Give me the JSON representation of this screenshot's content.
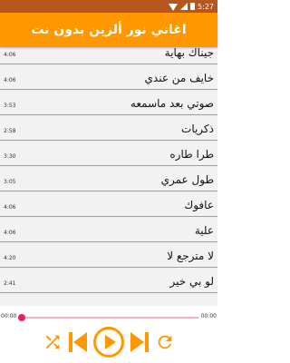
{
  "status_bar": {
    "time": "5:27"
  },
  "app_bar": {
    "title": "اغاني نور ألزين بدون نت"
  },
  "tracks": [
    {
      "title": "جيناك بهاية",
      "duration": "4:06"
    },
    {
      "title": "خايف من عندي",
      "duration": "4:06"
    },
    {
      "title": "صوتي بعد ماسمعه",
      "duration": "3:53"
    },
    {
      "title": "ذكريات",
      "duration": "2:58"
    },
    {
      "title": "طرا طاره",
      "duration": "3:30"
    },
    {
      "title": "طول عمري",
      "duration": "3:05"
    },
    {
      "title": "عافوك",
      "duration": "4:06"
    },
    {
      "title": "علية",
      "duration": "4:06"
    },
    {
      "title": "لا مترجع لا",
      "duration": "4:20"
    },
    {
      "title": "لو بي خير",
      "duration": "2:41"
    }
  ],
  "player": {
    "current_time": "00:00",
    "total_time": "00:00",
    "progress": 0,
    "icons": [
      "shuffle-icon",
      "previous-icon",
      "play-icon",
      "next-icon",
      "repeat-icon"
    ]
  },
  "colors": {
    "status_bar": "#b8561f",
    "app_bar": "#ff9800",
    "accent": "#e91e63",
    "controls": "#ff9800",
    "list_bg": "#f2f2f2"
  }
}
